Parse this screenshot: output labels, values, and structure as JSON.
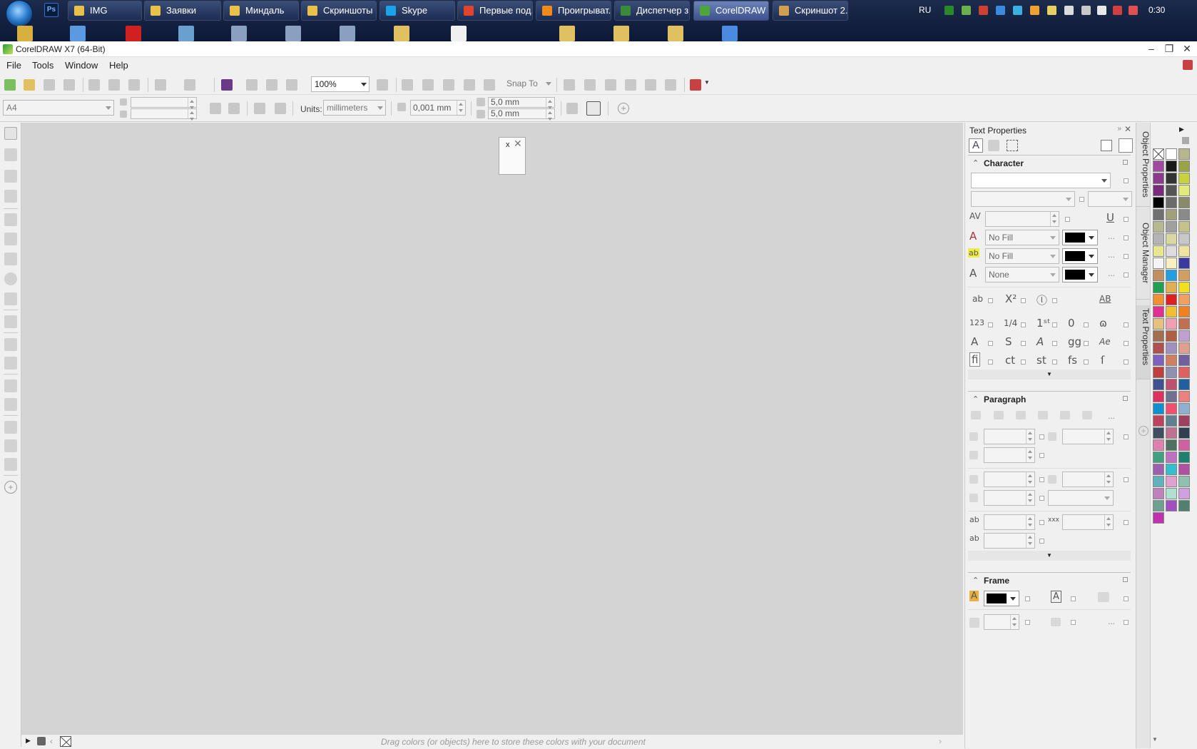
{
  "taskbar": {
    "buttons": [
      {
        "label": "IMG",
        "icon": "folder-icon",
        "color": "#e8c04a"
      },
      {
        "label": "Заявки",
        "icon": "folder-icon",
        "color": "#e8c04a"
      },
      {
        "label": "Миндаль",
        "icon": "folder-icon",
        "color": "#e8c04a"
      },
      {
        "label": "Скриншоты",
        "icon": "folder-icon",
        "color": "#e8c04a"
      },
      {
        "label": "Skype",
        "icon": "skype-icon",
        "color": "#1aa3e8"
      },
      {
        "label": "Первые под...",
        "icon": "chrome-icon",
        "color": "#e0442e"
      },
      {
        "label": "Проигрыват...",
        "icon": "media-player-icon",
        "color": "#f08a1a"
      },
      {
        "label": "Диспетчер з...",
        "icon": "task-manager-icon",
        "color": "#3b8a3b"
      },
      {
        "label": "CorelDRAW ...",
        "icon": "coreldraw-icon",
        "color": "#4ea63a"
      },
      {
        "label": "Скриншот 2...",
        "icon": "paint-icon",
        "color": "#d0a050"
      }
    ],
    "quick_photoshop": "Ps",
    "tray": {
      "lang": "RU",
      "clock": "0:30"
    }
  },
  "window": {
    "title": "CorelDRAW X7 (64-Bit)"
  },
  "menu": [
    "File",
    "Tools",
    "Window",
    "Help"
  ],
  "toolbar": {
    "zoom": "100%",
    "snap_to": "Snap To"
  },
  "propbar": {
    "page_size": "A4",
    "units_label": "Units:",
    "units": "millimeters",
    "nudge": "0,001 mm",
    "dup_x": "5,0 mm",
    "dup_y": "5,0 mm"
  },
  "canvas": {
    "page_x_text": "x",
    "page_close": "✕"
  },
  "doc_palette": {
    "hint": "Drag colors (or objects) here to store these colors with your document"
  },
  "docker": {
    "title": "Text Properties",
    "character": {
      "heading": "Character",
      "fill1": "No Fill",
      "fill2": "No Fill",
      "outline": "None"
    },
    "paragraph": {
      "heading": "Paragraph"
    },
    "frame": {
      "heading": "Frame"
    }
  },
  "docker_tabs": [
    "Object Properties",
    "Object Manager",
    "Text Properties"
  ],
  "palette_colors": [
    "#ffffff",
    "#b5b88a",
    "#a04aa0",
    "#1a1a1a",
    "#9aa24a",
    "#8a3a8a",
    "#333333",
    "#c8d23a",
    "#7a2a7a",
    "#555555",
    "#e4ea7a",
    "#000000",
    "#6b6b6b",
    "#8a8a6a",
    "#707070",
    "#a0a07a",
    "#8a8a8a",
    "#b8b890",
    "#a0a0a0",
    "#c4c48a",
    "#b4b4b4",
    "#d8d8a0",
    "#c8c8c8",
    "#e8e890",
    "#dcdcdc",
    "#f0e4a0",
    "#f4f4f4",
    "#f8f0c0",
    "#3a3aa0",
    "#c09060",
    "#20a0e0",
    "#d0a060",
    "#20a050",
    "#e0b050",
    "#f0e020",
    "#f09030",
    "#e02020",
    "#f0a060",
    "#e03090",
    "#f0c030",
    "#f08020",
    "#e8c080",
    "#f0a0b0",
    "#c07050",
    "#a07050",
    "#b06040",
    "#c0a0d0",
    "#b05050",
    "#a090c0",
    "#e0a090",
    "#8060c0",
    "#d08060",
    "#7060a0",
    "#c04040",
    "#9090b0",
    "#e06060",
    "#405090",
    "#c05070",
    "#2060a0",
    "#e03060",
    "#707090",
    "#f08080",
    "#1090d0",
    "#f05070",
    "#90b0d0",
    "#c04060",
    "#608090",
    "#a04060",
    "#405060",
    "#c07090",
    "#304050",
    "#e080b0",
    "#507060",
    "#d060a0",
    "#40a080",
    "#c070c0",
    "#208070",
    "#a060b0",
    "#30c0d0",
    "#b050a0",
    "#60b0c0",
    "#e0a0d0",
    "#90c0b0",
    "#c080c0",
    "#b0e0d0",
    "#d0a0e0",
    "#70a090",
    "#a050c0",
    "#508070",
    "#c030b0"
  ]
}
